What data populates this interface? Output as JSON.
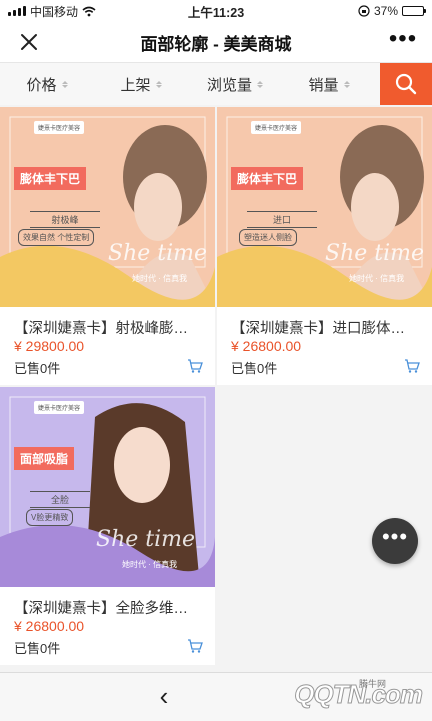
{
  "status_bar": {
    "carrier": "中国移动",
    "time": "上午11:23",
    "battery": "37%",
    "battery_level": 0.37
  },
  "nav": {
    "title": "面部轮廓 - 美美商城",
    "more": "•••"
  },
  "sort_bar": {
    "items": [
      "价格",
      "上架",
      "浏览量",
      "销量"
    ]
  },
  "products": [
    {
      "title": "【深圳婕熹卡】射极峰膨…",
      "price": "¥ 29800.00",
      "sold": "已售0件",
      "banner": {
        "logo": "婕熹卡医疗美容",
        "headline": "膨体丰下巴",
        "tag": "射极峰",
        "tagline": "效果自然 个性定制",
        "script": "She time",
        "slogan": "她时代 · 信真我"
      },
      "colors": {
        "bg": "#f6c8ac",
        "wave": "#f3c862"
      }
    },
    {
      "title": "【深圳婕熹卡】进口膨体…",
      "price": "¥ 26800.00",
      "sold": "已售0件",
      "banner": {
        "logo": "婕熹卡医疗美容",
        "headline": "膨体丰下巴",
        "tag": "进口",
        "tagline": "塑造迷人侧脸",
        "script": "She time",
        "slogan": "她时代 · 信真我"
      },
      "colors": {
        "bg": "#f6c8ac",
        "wave": "#f3c862"
      }
    },
    {
      "title": "【深圳婕熹卡】全脸多维…",
      "price": "¥ 26800.00",
      "sold": "已售0件",
      "banner": {
        "logo": "婕熹卡医疗美容",
        "headline": "面部吸脂",
        "tag": "全脸",
        "tagline": "V脸更精致",
        "script": "She time",
        "slogan": "她时代 · 信真我"
      },
      "colors": {
        "bg": "#c6b8ec",
        "wave": "#a78ad9"
      }
    }
  ],
  "floating_button": {
    "label": "•••"
  },
  "bottom_bar": {
    "back": "‹",
    "watermark": "QQTN.com",
    "watermark_badge": "腾牛网"
  },
  "accent_color": "#f05b2e",
  "price_color": "#e9532a"
}
